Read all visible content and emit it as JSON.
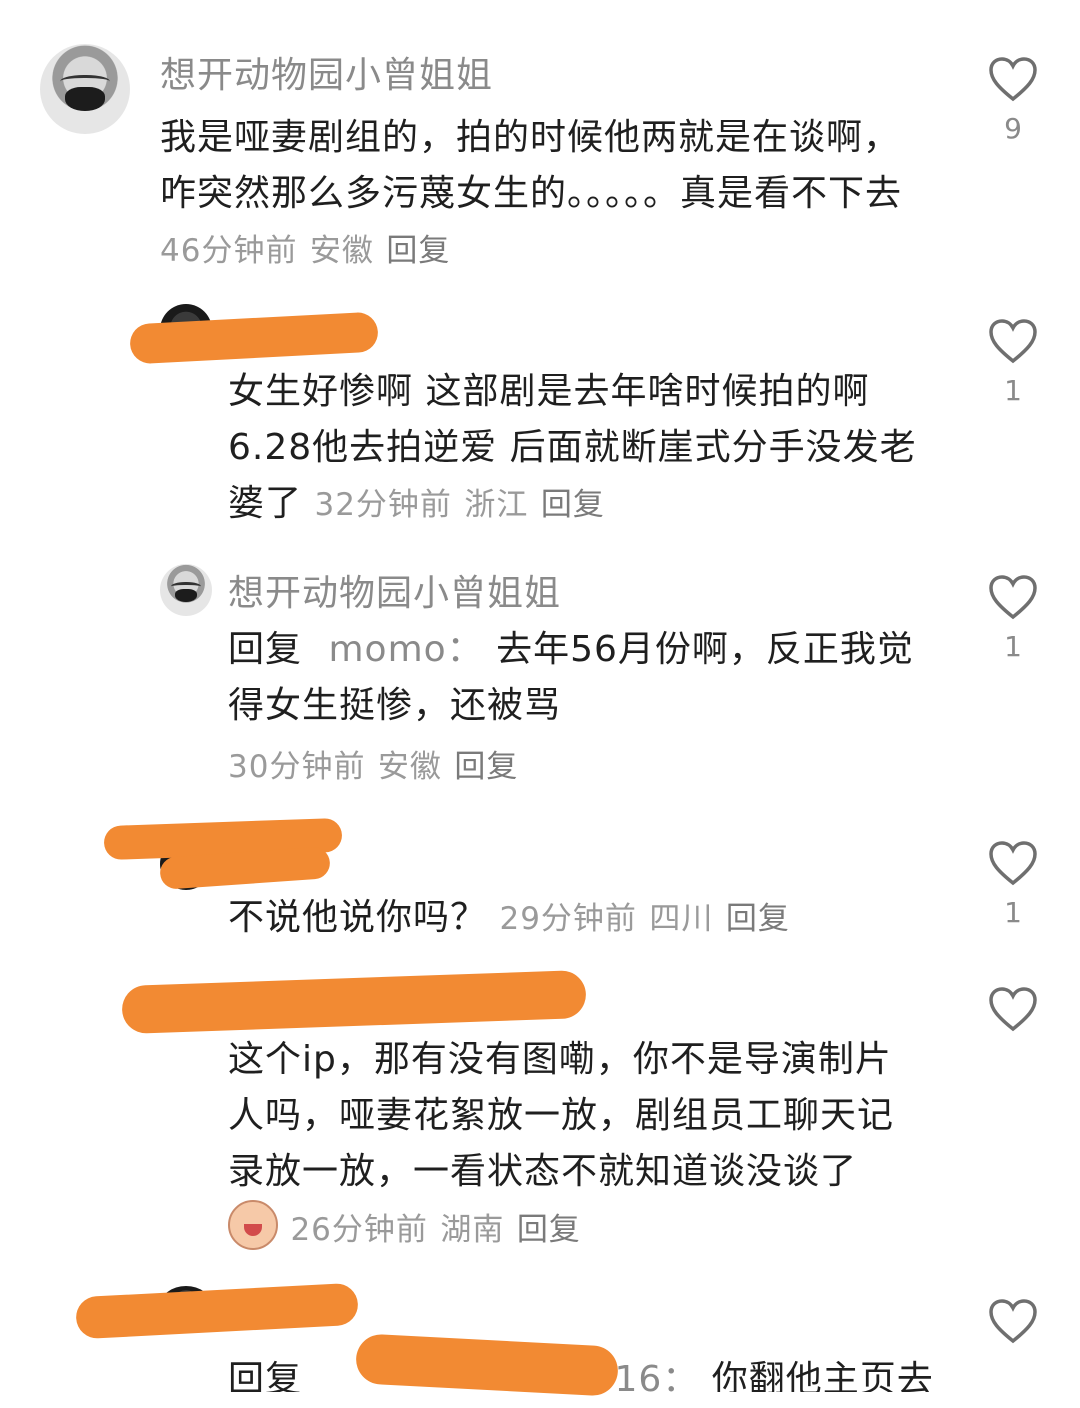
{
  "comments": [
    {
      "username": "想开动物园小曾姐姐",
      "text": "我是哑妻剧组的，拍的时候他两就是在谈啊，咋突然那么多污蔑女生的。。。。。真是看不下去",
      "time": "46分钟前",
      "location": "安徽",
      "reply_label": "回复",
      "likes": "9"
    },
    {
      "username": "",
      "text": "女生好惨啊 这部剧是去年啥时候拍的啊 6.28他去拍逆爱 后面就断崖式分手没发老婆了",
      "time": "32分钟前",
      "location": "浙江",
      "reply_label": "回复",
      "likes": "1"
    },
    {
      "username": "想开动物园小曾姐姐",
      "reply_prefix": "回复",
      "mention": "momo：",
      "text": "去年56月份啊，反正我觉得女生挺惨，还被骂",
      "time": "30分钟前",
      "location": "安徽",
      "reply_label": "回复",
      "likes": "1"
    },
    {
      "username": "",
      "text": "不说他说你吗？",
      "time": "29分钟前",
      "location": "四川",
      "reply_label": "回复",
      "likes": "1"
    },
    {
      "username": "",
      "text": "这个ip，那有没有图嘞，你不是导演制片人吗，哑妻花絮放一放，剧组员工聊天记录放一放，一看状态不就知道谈没谈了",
      "time": "26分钟前",
      "location": "湖南",
      "reply_label": "回复",
      "likes": ""
    },
    {
      "username": "",
      "reply_prefix": "回复",
      "mention": "16：",
      "text": "你翻他主页去",
      "likes": ""
    }
  ],
  "icons": {
    "like": "heart-outline-icon",
    "emoji": "crying-face-emoji"
  },
  "colors": {
    "scribble": "#f28a33",
    "meta": "#9a9a9a",
    "username": "#8a8a8a"
  }
}
